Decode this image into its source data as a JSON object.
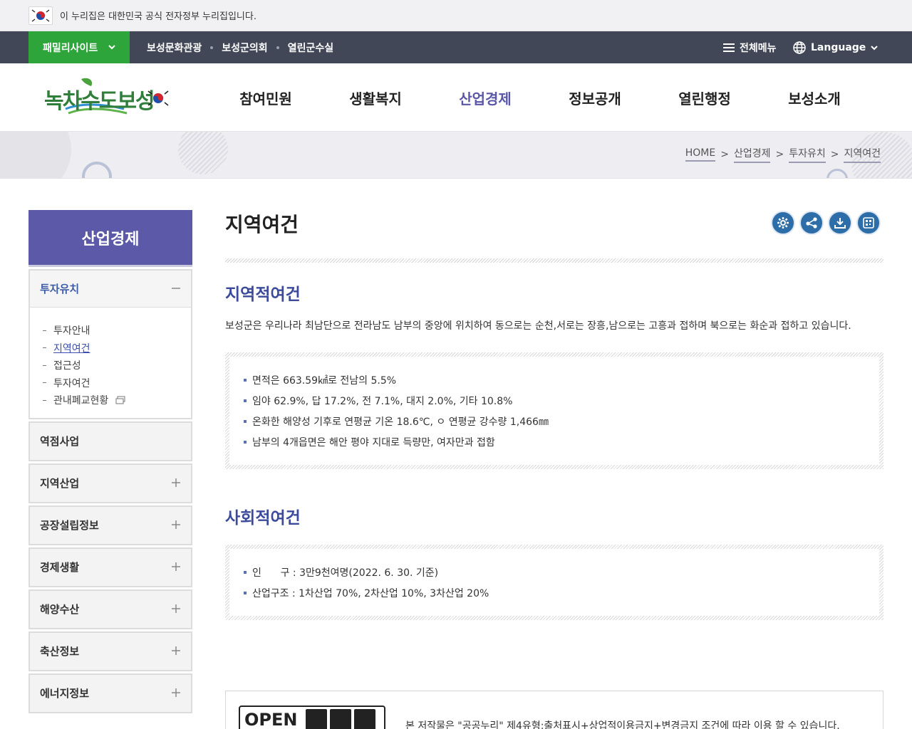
{
  "gov_banner": {
    "text": "이 누리집은 대한민국 공식 전자정부 누리집입니다."
  },
  "util_bar": {
    "family_label": "패밀리사이트",
    "links": [
      "보성문화관광",
      "보성군의회",
      "열린군수실"
    ],
    "all_menu_label": "전체메뉴",
    "language_label": "Language"
  },
  "header": {
    "logo_text": "녹차수도보성",
    "gnb": [
      {
        "label": "참여민원",
        "active": false
      },
      {
        "label": "생활복지",
        "active": false
      },
      {
        "label": "산업경제",
        "active": true
      },
      {
        "label": "정보공개",
        "active": false
      },
      {
        "label": "열린행정",
        "active": false
      },
      {
        "label": "보성소개",
        "active": false
      }
    ]
  },
  "breadcrumb": [
    "HOME",
    "산업경제",
    "투자유치",
    "지역여건"
  ],
  "lnb": {
    "title": "산업경제",
    "open_group": {
      "label": "투자유치",
      "items": [
        {
          "label": "투자안내",
          "active": false
        },
        {
          "label": "지역여건",
          "active": true
        },
        {
          "label": "접근성",
          "active": false
        },
        {
          "label": "투자여건",
          "active": false
        },
        {
          "label": "관내폐교현황",
          "active": false
        }
      ]
    },
    "groups": [
      {
        "label": "역점사업",
        "has_children": false
      },
      {
        "label": "지역산업",
        "has_children": true
      },
      {
        "label": "공장설립정보",
        "has_children": true
      },
      {
        "label": "경제생활",
        "has_children": true
      },
      {
        "label": "해양수산",
        "has_children": true
      },
      {
        "label": "축산정보",
        "has_children": true
      },
      {
        "label": "에너지정보",
        "has_children": true
      }
    ]
  },
  "content": {
    "page_title": "지역여건",
    "section1": {
      "title": "지역적여건",
      "desc": "보성군은 우리나라 최남단으로 전라남도 남부의 중앙에 위치하여 동으로는 순천,서로는 장흥,남으로는 고흥과 접하며 북으로는 화순과 접하고 있습니다.",
      "bullets": [
        "면적은 663.59㎢로 전남의 5.5%",
        "임야 62.9%, 답 17.2%, 전 7.1%, 대지 2.0%, 기타 10.8%",
        "온화한 해양성 기후로 연평균 기온 18.6℃, ㅇ 연평균 강수량 1,466㎜",
        "남부의 4개읍면은 해안 평야 지대로 득량만, 여자만과 접함"
      ]
    },
    "section2": {
      "title": "사회적여건",
      "bullets": [
        "인      구 : 3만9천여명(2022. 6. 30. 기준)",
        "산업구조 : 1차산업 70%, 2차산업 10%, 3차산업 20%"
      ]
    },
    "open_license": {
      "badge": "OPEN",
      "text": "본 저작물은 \"공공누리\" 제4유형:출처표시+상업적이용금지+변경금지 조건에 따라 이용 할 수 있습니다."
    }
  },
  "colors": {
    "util_bar": "#414757",
    "family_green": "#2ea53a",
    "lnb_title": "#5c5aa8",
    "accent": "#3b4a9a",
    "tool_blue": "#2d6ea8"
  }
}
